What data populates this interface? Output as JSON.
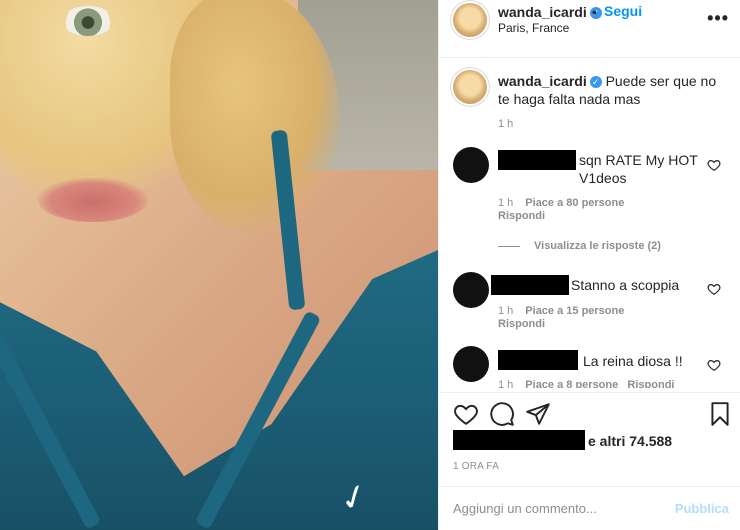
{
  "post": {
    "username": "wanda_icardi",
    "location": "Paris, France",
    "follow_label": "Segui",
    "dot": "•",
    "more_label": "•••",
    "caption": "Puede ser que no te haga falta nada mas",
    "caption_time": "1 h"
  },
  "comments": [
    {
      "text": "sqn RATE My HOT V1deos",
      "time": "1 h",
      "likes": "Piace a 80 persone",
      "reply": "Rispondi",
      "view_replies": "Visualizza le risposte (2)"
    },
    {
      "text": "Stanno a scoppia",
      "time": "1 h",
      "likes": "Piace a 15 persone",
      "reply": "Rispondi"
    },
    {
      "text": "La reina diosa !!",
      "time": "1 h",
      "likes": "Piace a 8 persone",
      "reply": "Rispondi"
    }
  ],
  "footer": {
    "likes_suffix": "e altri 74.588",
    "time_ago": "1 ORA FA",
    "comment_placeholder": "Aggiungi un commento...",
    "publish_label": "Pubblica"
  },
  "colors": {
    "accent": "#0095f6",
    "verified": "#3897f0",
    "publish_disabled": "#b2dffc"
  }
}
